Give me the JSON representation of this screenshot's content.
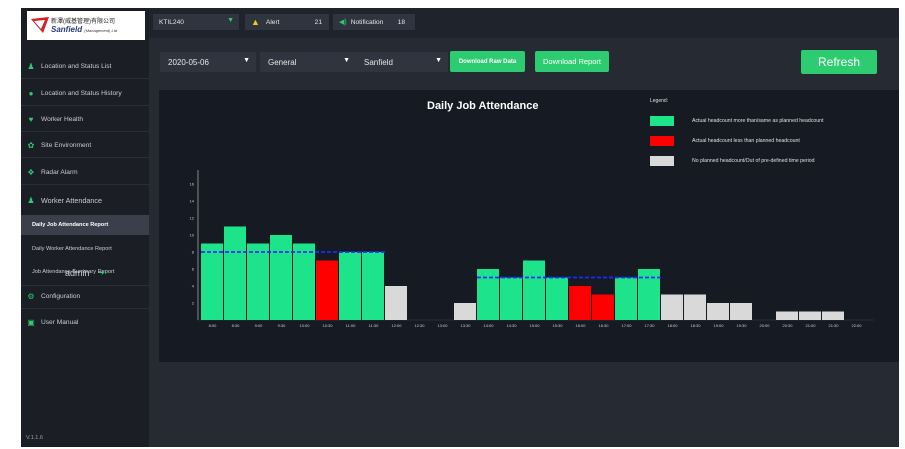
{
  "logo": {
    "line1": "新澤(威基管理)有限公司",
    "line2": "Sanfield",
    "line2_small": "(Management) Ltd"
  },
  "topbar": {
    "site": "KTIL240",
    "alert_label": "Alert",
    "alert_count": "21",
    "notification_label": "Notification",
    "notification_count": "18"
  },
  "sidebar": {
    "items": [
      {
        "label": "Location and Status List",
        "icon": "person-icon"
      },
      {
        "label": "Location and Status History",
        "icon": "location-icon"
      },
      {
        "label": "Worker Health",
        "icon": "heart-icon"
      },
      {
        "label": "Site Environment",
        "icon": "leaf-icon"
      },
      {
        "label": "Radar Alarm",
        "icon": "radar-icon"
      },
      {
        "label": "Worker Attendance",
        "icon": "person-icon"
      }
    ],
    "sub_items": [
      {
        "label": "Daily Job Attendance Report",
        "active": true
      },
      {
        "label": "Daily Worker Attendance Report",
        "active": false
      },
      {
        "label": "Job Attendance Summary Report",
        "active": false
      }
    ],
    "bottom_items": [
      {
        "label": "Configuration",
        "icon": "gear-icon"
      },
      {
        "label": "User Manual",
        "icon": "book-icon"
      }
    ],
    "user": "admin",
    "version": "V.1.1.6"
  },
  "controls": {
    "date": "2020-05-06",
    "category": "General",
    "company": "Sanfield",
    "download_raw_label": "Download Raw Data",
    "download_report_label": "Download Report",
    "refresh_label": "Refresh"
  },
  "colors": {
    "accent": "#2ecc71",
    "bar_met": "#1de38a",
    "bar_below": "#ff0000",
    "bar_none": "#d9d9d9",
    "planned_line": "#1a2cff",
    "alert_icon": "#f5c518",
    "notification_icon": "#2ecc71"
  },
  "chart_data": {
    "type": "bar",
    "title": "Daily Job Attendance",
    "legend_title": "Legend:",
    "legend": [
      {
        "label": "Actual headcount more than/same as planned headcount",
        "color": "#1de38a"
      },
      {
        "label": "Actual headcount less than planned headcount",
        "color": "#ff0000"
      },
      {
        "label": "No planned headcount/Out of pre-defined time period",
        "color": "#d9d9d9"
      }
    ],
    "categories": [
      "8:00",
      "8:30",
      "9:00",
      "9:30",
      "10:00",
      "10:30",
      "11:00",
      "11:30",
      "12:00",
      "12:30",
      "13:00",
      "13:30",
      "14:00",
      "14:30",
      "15:00",
      "15:30",
      "16:00",
      "16:30",
      "17:00",
      "17:30",
      "18:00",
      "18:30",
      "19:00",
      "19:30",
      "20:00",
      "20:30",
      "21:00",
      "21:30",
      "22:00"
    ],
    "values": [
      9,
      11,
      9,
      10,
      9,
      7,
      8,
      8,
      4,
      0,
      0,
      2,
      6,
      5,
      7,
      5,
      4,
      3,
      5,
      6,
      3,
      3,
      2,
      2,
      0,
      1,
      1,
      1,
      0
    ],
    "status": [
      "met",
      "met",
      "met",
      "met",
      "met",
      "below",
      "met",
      "met",
      "none",
      "none",
      "none",
      "none",
      "met",
      "met",
      "met",
      "met",
      "below",
      "below",
      "met",
      "met",
      "none",
      "none",
      "none",
      "none",
      "none",
      "none",
      "none",
      "none",
      "none"
    ],
    "planned": [
      {
        "from": "8:00",
        "to": "12:00",
        "value": 8
      },
      {
        "from": "14:00",
        "to": "18:00",
        "value": 5
      }
    ],
    "yticks": [
      2,
      4,
      6,
      8,
      10,
      12,
      14,
      16
    ],
    "ylim": [
      0,
      17
    ]
  }
}
